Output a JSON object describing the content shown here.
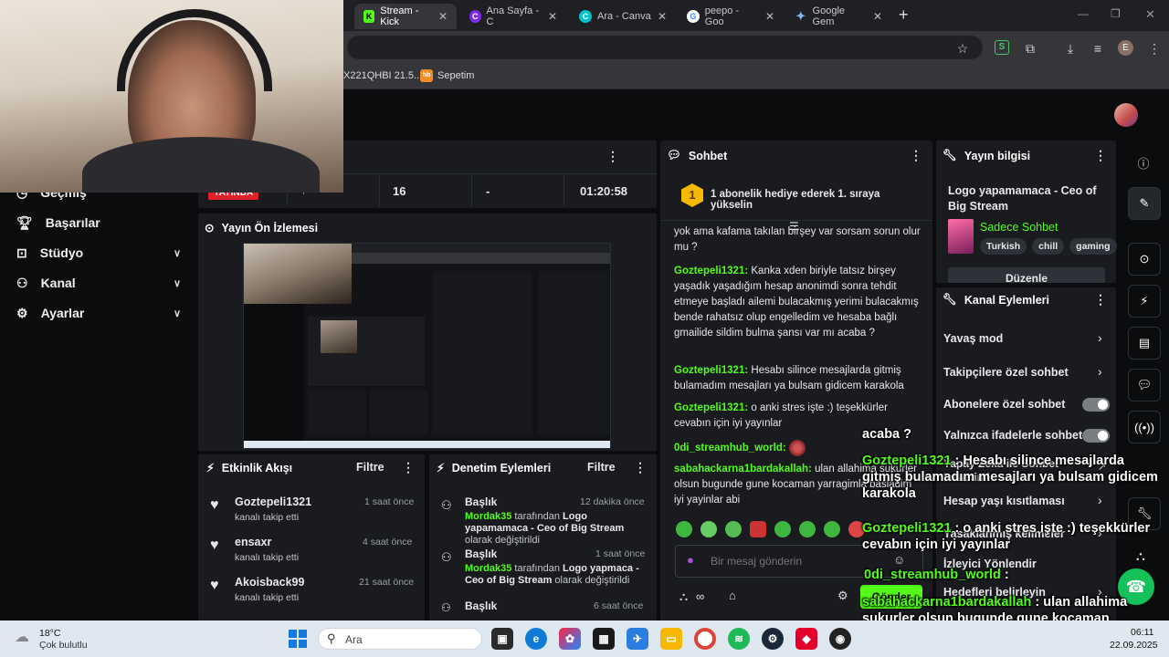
{
  "browser": {
    "tabs": [
      {
        "label": "Stream - Kick",
        "favicon": "K",
        "color": "#53fc18"
      },
      {
        "label": "Ana Sayfa - C",
        "favicon": "C",
        "color": "#7d2ae8"
      },
      {
        "label": "Ara - Canva",
        "favicon": "C",
        "color": "#00c4cc"
      },
      {
        "label": "peepo - Goo",
        "favicon": "G",
        "color": "#ffffff"
      },
      {
        "label": "Google Gem",
        "favicon": "✦",
        "color": "#8ab4f8"
      }
    ],
    "bookmarks": [
      {
        "label": "X221QHBI 21.5..."
      },
      {
        "label": "Sepetim",
        "favicon": "hb"
      }
    ],
    "profile_letter": "E"
  },
  "sidebar": {
    "items": [
      {
        "label": "Geçmiş",
        "icon": "history-icon",
        "chev": false
      },
      {
        "label": "Başarılar",
        "icon": "trophy-icon",
        "chev": false
      },
      {
        "label": "Stüdyo",
        "icon": "studio-icon",
        "chev": true
      },
      {
        "label": "Kanal",
        "icon": "channel-icon",
        "chev": true
      },
      {
        "label": "Ayarlar",
        "icon": "settings-icon",
        "chev": true
      }
    ]
  },
  "stats": {
    "live_badge": "YAYINDA",
    "viewers": "16",
    "other": "-",
    "uptime": "01:20:58"
  },
  "preview": {
    "title": "Yayın Ön İzlemesi"
  },
  "activity": {
    "title": "Etkinlik Akışı",
    "filter": "Filtre",
    "items": [
      {
        "user": "Goztepeli1321",
        "action": "kanalı takip etti",
        "time": "1 saat önce"
      },
      {
        "user": "ensaxr",
        "action": "kanalı takip etti",
        "time": "4 saat önce"
      },
      {
        "user": "Akoisback99",
        "action": "kanalı takip etti",
        "time": "21 saat önce"
      }
    ]
  },
  "moderation": {
    "title": "Denetim Eylemleri",
    "filter": "Filtre",
    "items": [
      {
        "heading": "Başlık",
        "time": "12 dakika önce",
        "actor": "Mordak35",
        "mid": "tarafından",
        "value": "Logo yapamamaca - Ceo of Big Stream",
        "tail": "olarak değiştirildi"
      },
      {
        "heading": "Başlık",
        "time": "1 saat önce",
        "actor": "Mordak35",
        "mid": "tarafından",
        "value": "Logo yapmaca - Ceo of Big Stream",
        "tail": "olarak değiştirildi"
      },
      {
        "heading": "Başlık",
        "time": "6 saat önce"
      }
    ]
  },
  "chat": {
    "title": "Sohbet",
    "goal_rank": "1",
    "goal_text": "1 abonelik hediye ederek 1. sıraya yükselin",
    "partial_top": "yok ama kafama takılan birşey var sorsam sorun olur mu ?",
    "messages": [
      {
        "user": "Goztepeli1321",
        "text": "Kanka xden biriyle tatsız birşey yaşadık yaşadığım hesap anonimdi sonra tehdit etmeye başladı ailemi bulacakmış yerimi bulacakmış bende rahatsız olup engelledim ve hesaba bağlı gmailide sildim bulma şansı var mı acaba ?"
      },
      {
        "user": "Goztepeli1321",
        "text": "Hesabı silince mesajlarda gitmiş bulamadım mesajları ya bulsam gidicem karakola"
      },
      {
        "user": "Goztepeli1321",
        "text": "o anki stres işte :) teşekkürler cevabın için iyi yayınlar"
      },
      {
        "user": "0di_streamhub_world",
        "text": ""
      },
      {
        "user": "sabahackarna1bardakallah",
        "text": "ulan allahima sukurler olsun bugunde gune kocaman yarragimla basladim iyi yayinlar abi"
      }
    ],
    "placeholder": "Bir mesaj gönderin",
    "send": "Gönder"
  },
  "info": {
    "title": "Yayın bilgisi",
    "stream_title": "Logo yapamamaca - Ceo of Big Stream",
    "category": "Sadece Sohbet",
    "tags": [
      "Turkish",
      "chill",
      "gaming"
    ],
    "edit": "Düzenle"
  },
  "channel_actions": {
    "title": "Kanal Eylemleri",
    "items": [
      {
        "label": "Yavaş mod",
        "type": "chevron"
      },
      {
        "label": "Takipçilere özel sohbet",
        "type": "chevron"
      },
      {
        "label": "Abonelere özel sohbet",
        "type": "toggle"
      },
      {
        "label": "Yalnızca ifadelerle sohbet",
        "type": "toggle"
      },
      {
        "label": "Yapay Zeka ile Sohbet Denetimi",
        "type": "link"
      },
      {
        "label": "Hesap yaşı kısıtlaması",
        "type": "chevron"
      },
      {
        "label": "Yasaklanmış kelimeler",
        "type": "chevron"
      },
      {
        "label": "İzleyici Yönlendir",
        "type": "none"
      },
      {
        "label": "Hedefleri belirleyin",
        "type": "chevron"
      }
    ]
  },
  "overlay": {
    "lines": [
      {
        "user": "",
        "text": "acaba ?"
      },
      {
        "user": "Goztepeli1321",
        "text": "Hesabı silince mesajlarda gitmiş bulamadım mesajları ya bulsam gidicem karakola"
      },
      {
        "user": "Goztepeli1321",
        "text": "o anki stres işte :) teşekkürler cevabın için iyi yayınlar"
      },
      {
        "user": "0di_streamhub_world",
        "text": ""
      },
      {
        "user": "sabahackarna1bardakallah",
        "text": "ulan allahima sukurler olsun bugunde gune kocaman yarragimla basladim iyi yayinlar abi"
      }
    ]
  },
  "taskbar": {
    "weather_temp": "18°C",
    "weather_desc": "Çok bulutlu",
    "search": "Ara",
    "time": "06:11",
    "date": "22.09.2025"
  }
}
